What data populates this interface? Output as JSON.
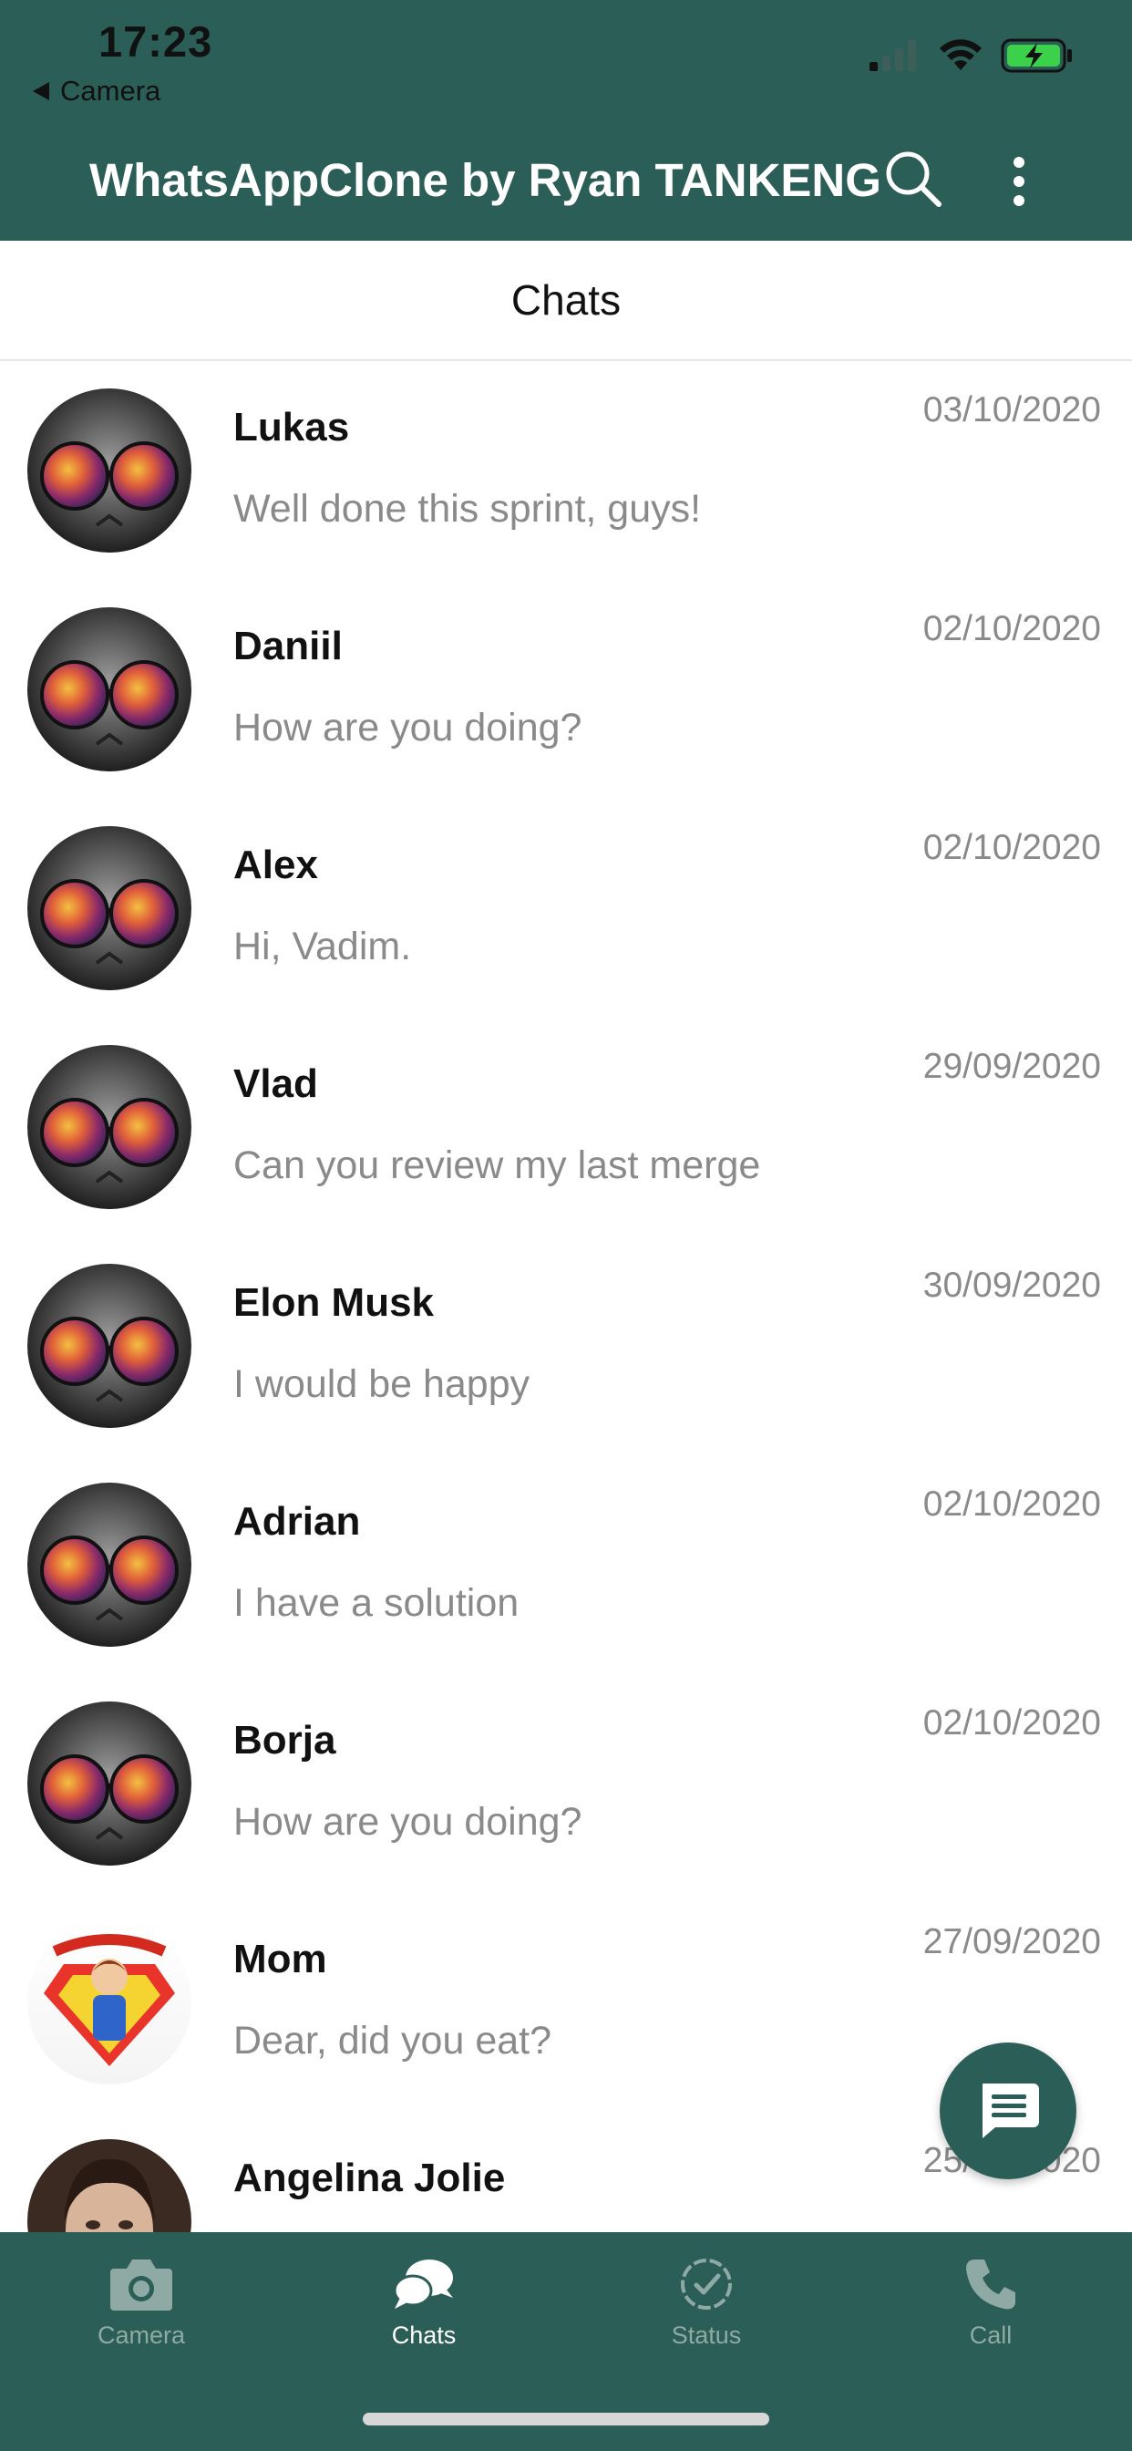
{
  "status_bar": {
    "time": "17:23",
    "back_app": "Camera"
  },
  "header": {
    "title": "WhatsAppClone by Ryan TANKENG",
    "search_icon": "search-icon",
    "more_icon": "more-vertical-icon"
  },
  "tab": {
    "title": "Chats"
  },
  "chats": [
    {
      "name": "Lukas",
      "message": "Well done this sprint, guys!",
      "date": "03/10/2020",
      "avatar": "cat-glasses"
    },
    {
      "name": "Daniil",
      "message": "How are you doing?",
      "date": "02/10/2020",
      "avatar": "cat-glasses"
    },
    {
      "name": "Alex",
      "message": "Hi, Vadim.",
      "date": "02/10/2020",
      "avatar": "cat-glasses"
    },
    {
      "name": "Vlad",
      "message": "Can you review my last merge",
      "date": "29/09/2020",
      "avatar": "cat-glasses"
    },
    {
      "name": "Elon Musk",
      "message": "I would be happy",
      "date": "30/09/2020",
      "avatar": "cat-glasses"
    },
    {
      "name": "Adrian",
      "message": "I have a solution",
      "date": "02/10/2020",
      "avatar": "cat-glasses"
    },
    {
      "name": "Borja",
      "message": "How are you doing?",
      "date": "02/10/2020",
      "avatar": "cat-glasses"
    },
    {
      "name": "Mom",
      "message": "Dear, did you eat?",
      "date": "27/09/2020",
      "avatar": "supermum"
    },
    {
      "name": "Angelina Jolie",
      "message": "",
      "date": "25/09/2020",
      "avatar": "portrait"
    }
  ],
  "fab": {
    "icon": "new-chat-icon"
  },
  "bottom_nav": [
    {
      "label": "Camera",
      "icon": "camera-icon",
      "active": false
    },
    {
      "label": "Chats",
      "icon": "chats-icon",
      "active": true
    },
    {
      "label": "Status",
      "icon": "status-icon",
      "active": false
    },
    {
      "label": "Call",
      "icon": "phone-icon",
      "active": false
    }
  ],
  "colors": {
    "primary": "#2a5e56",
    "text_secondary": "#8a8a8a",
    "nav_inactive": "#8fa9a4"
  }
}
